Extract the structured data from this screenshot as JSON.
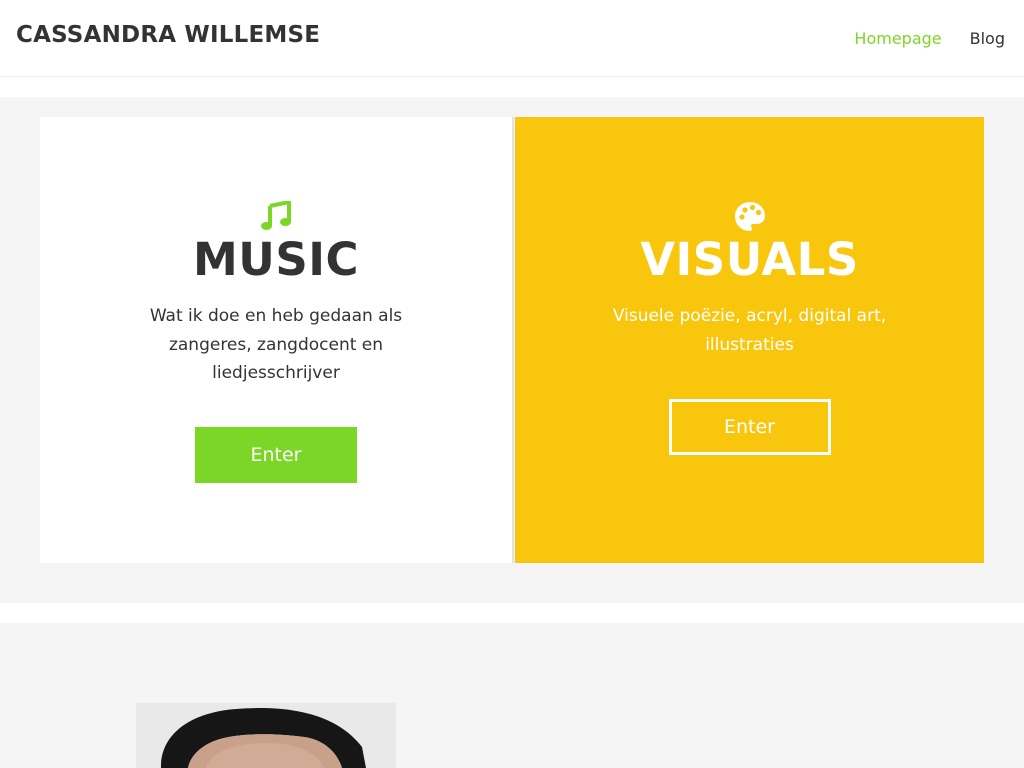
{
  "header": {
    "site_title": "CASSANDRA WILLEMSE",
    "nav": [
      {
        "label": "Homepage",
        "active": true
      },
      {
        "label": "Blog",
        "active": false
      }
    ]
  },
  "cards": {
    "music": {
      "icon": "music-note-icon",
      "title": "MUSIC",
      "text": "Wat ik doe en heb gedaan als zangeres, zangdocent en liedjesschrijver",
      "button": "Enter"
    },
    "visuals": {
      "icon": "palette-icon",
      "title": "VISUALS",
      "text": "Visuele poëzie, acryl, digital art, illustraties",
      "button": "Enter"
    }
  },
  "bio": {
    "portrait": "portrait-photo"
  },
  "colors": {
    "accent_green": "#7cd628",
    "accent_yellow": "#f8c70d",
    "text_dark": "#333333",
    "section_gray": "#f5f5f5"
  }
}
